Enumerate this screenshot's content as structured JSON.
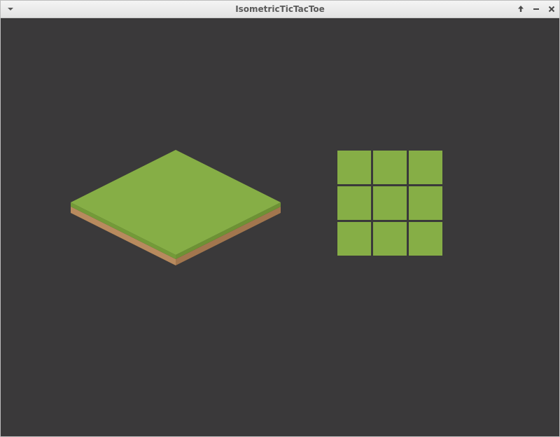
{
  "window": {
    "title": "IsometricTicTacToe",
    "icons": {
      "menu": "chevron-down-icon",
      "maximize": "arrow-up-icon",
      "minimize": "minus-icon",
      "close": "close-icon"
    }
  },
  "colors": {
    "background": "#3a393a",
    "grass_top": "#86ae46",
    "grass_side": "#739a38",
    "dirt": "#b88a5e",
    "dirt_dark": "#a2764e",
    "cell": "#86ae46"
  },
  "board": {
    "rows": 3,
    "cols": 3,
    "cells": [
      [
        "",
        "",
        ""
      ],
      [
        "",
        "",
        ""
      ],
      [
        "",
        "",
        ""
      ]
    ]
  }
}
